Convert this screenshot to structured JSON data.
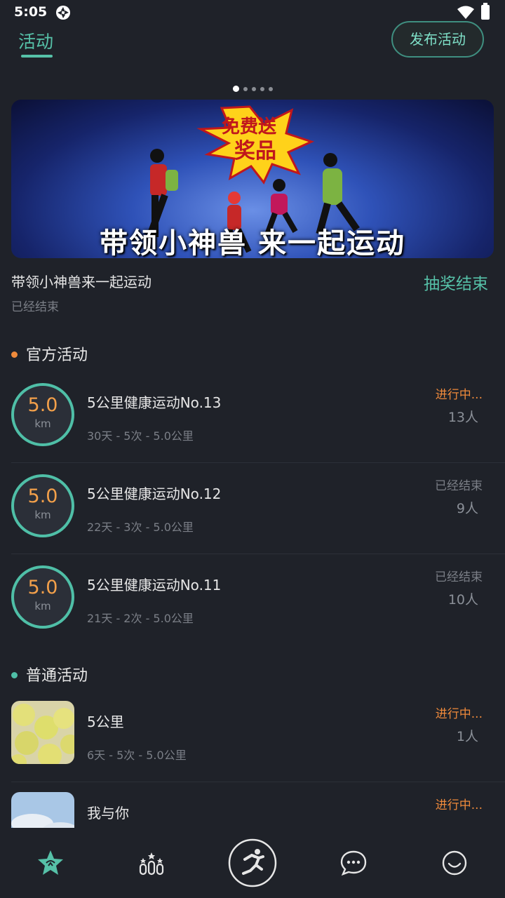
{
  "status_bar": {
    "time": "5:05"
  },
  "header": {
    "tab_label": "活动",
    "publish_label": "发布活动"
  },
  "carousel": {
    "count": 5,
    "active_index": 0
  },
  "banner": {
    "overlay_text": "带领小神兽 来一起运动",
    "burst_line1": "免费送",
    "burst_line2": "奖品"
  },
  "featured": {
    "title": "带领小神兽来一起运动",
    "status": "已经结束",
    "action": "抽奖结束"
  },
  "official_section": {
    "title": "官方活动",
    "bullet_color": "#ef8a3b",
    "items": [
      {
        "value": "5.0",
        "unit": "km",
        "title": "5公里健康运动No.13",
        "meta": "30天 - 5次 - 5.0公里",
        "state": "进行中...",
        "count": "13人"
      },
      {
        "value": "5.0",
        "unit": "km",
        "title": "5公里健康运动No.12",
        "meta": "22天 - 3次 - 5.0公里",
        "state": "已经结束",
        "count": "9人"
      },
      {
        "value": "5.0",
        "unit": "km",
        "title": "5公里健康运动No.11",
        "meta": "21天 - 2次 - 5.0公里",
        "state": "已经结束",
        "count": "10人"
      }
    ]
  },
  "normal_section": {
    "title": "普通活动",
    "bullet_color": "#4fbfa7",
    "items": [
      {
        "title": "5公里",
        "meta": "6天 - 5次 - 5.0公里",
        "state": "进行中...",
        "count": "1人"
      },
      {
        "title": "我与你",
        "meta": "",
        "state": "进行中...",
        "count": ""
      }
    ]
  },
  "colors": {
    "accent": "#56c1a8",
    "in_progress": "#ef8a3b",
    "background": "#1f2229"
  },
  "bottom_nav": {
    "items": [
      {
        "icon": "star-ribbon-icon",
        "active": true
      },
      {
        "icon": "ranking-icon",
        "active": false
      },
      {
        "icon": "running-man-icon",
        "active": false
      },
      {
        "icon": "chat-bubble-icon",
        "active": false
      },
      {
        "icon": "smiley-face-icon",
        "active": false
      }
    ]
  }
}
